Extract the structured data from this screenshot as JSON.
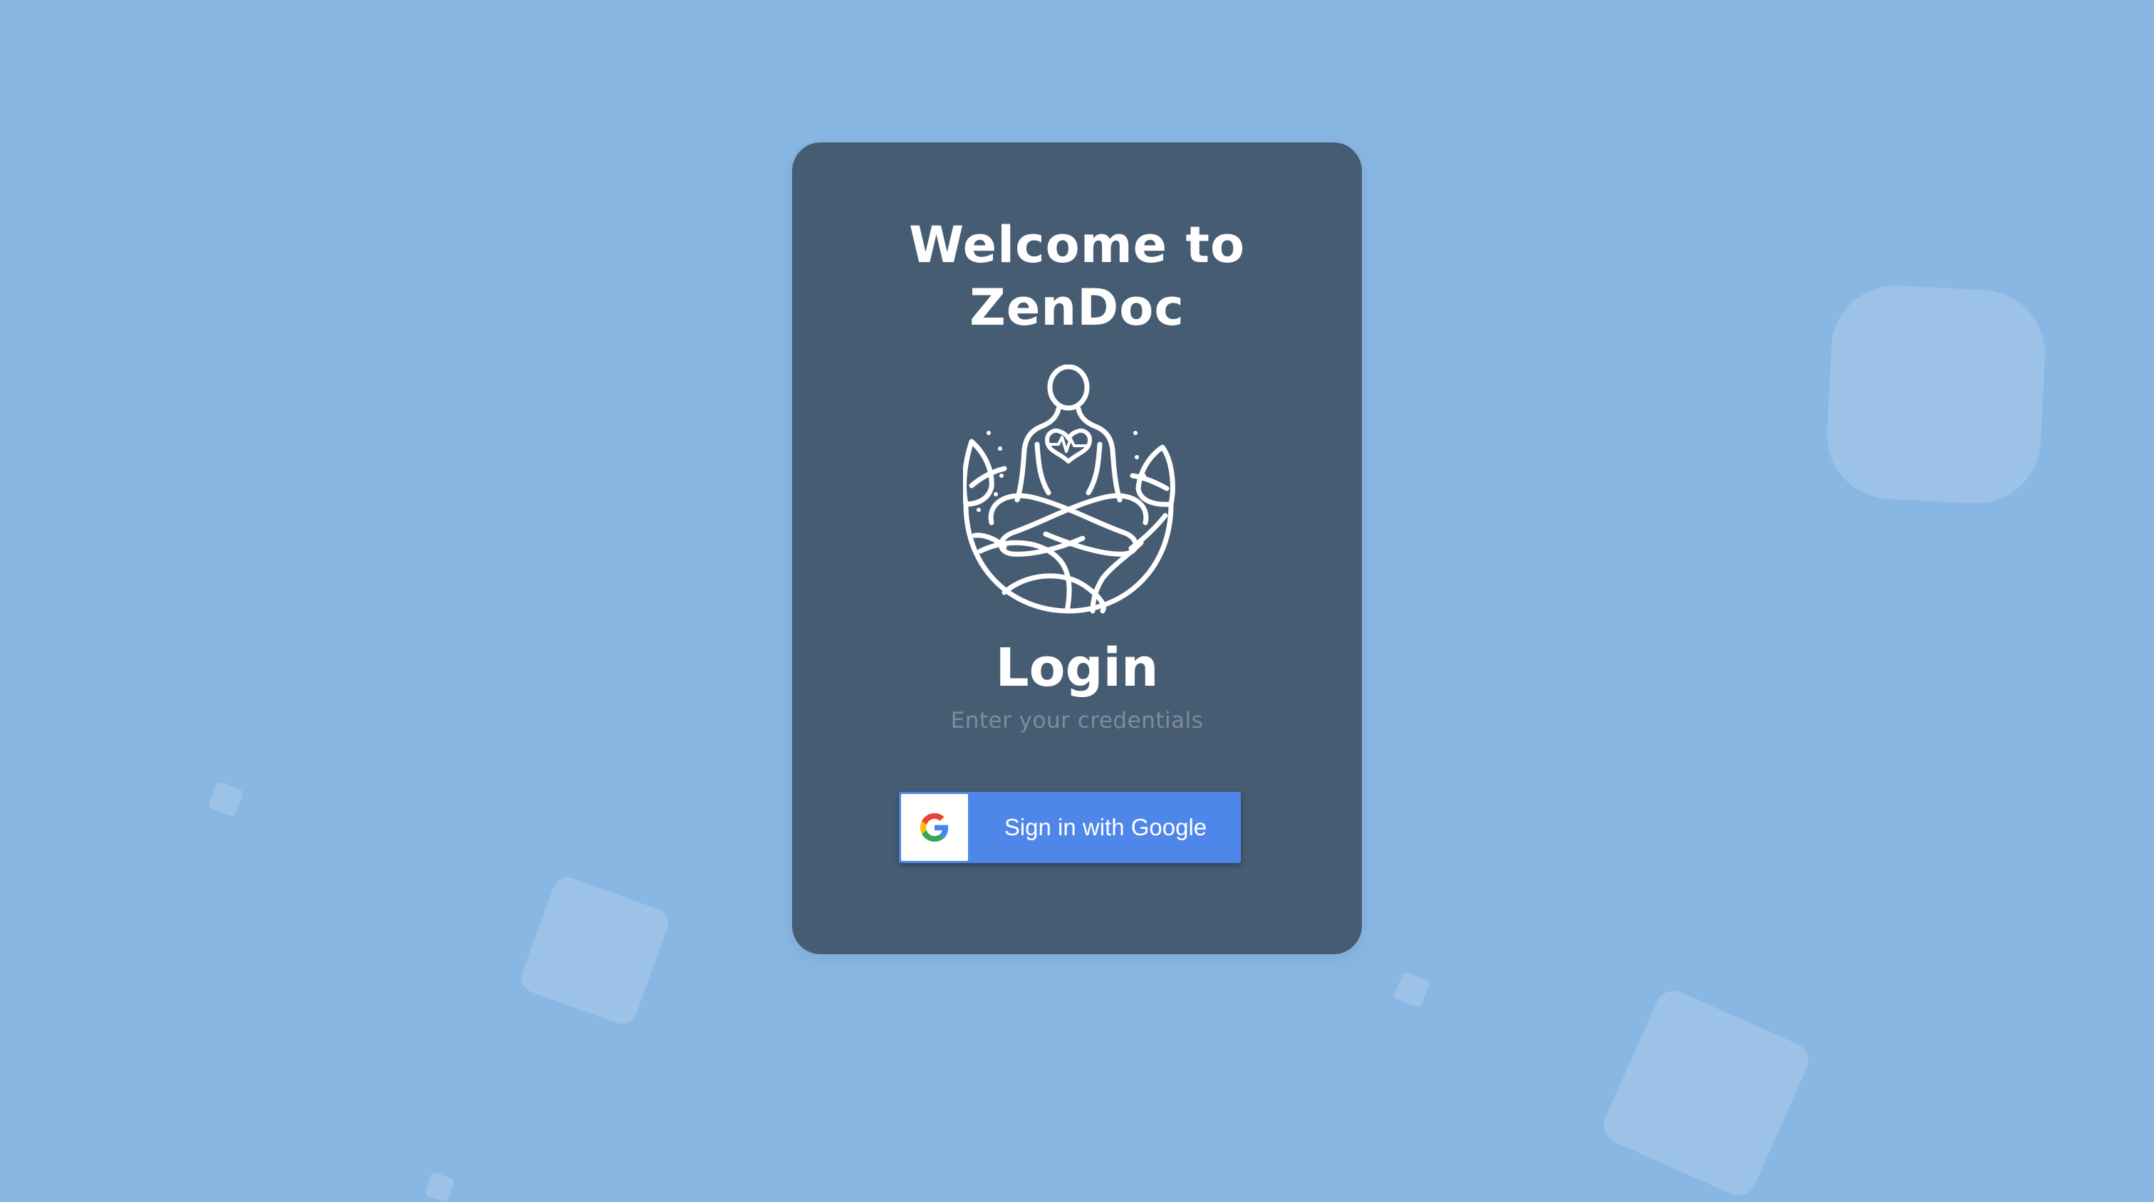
{
  "welcome": {
    "line1": "Welcome to",
    "line2": "ZenDoc"
  },
  "logo": {
    "icon": "meditation-heart-icon"
  },
  "login": {
    "title": "Login",
    "subtitle": "Enter your credentials"
  },
  "google_button": {
    "label": "Sign in with Google",
    "icon": "google-g-icon"
  },
  "colors": {
    "background": "#89b7e4",
    "card": "#465c73",
    "button": "#4f86ea",
    "subtitle": "#7f8b9a"
  }
}
